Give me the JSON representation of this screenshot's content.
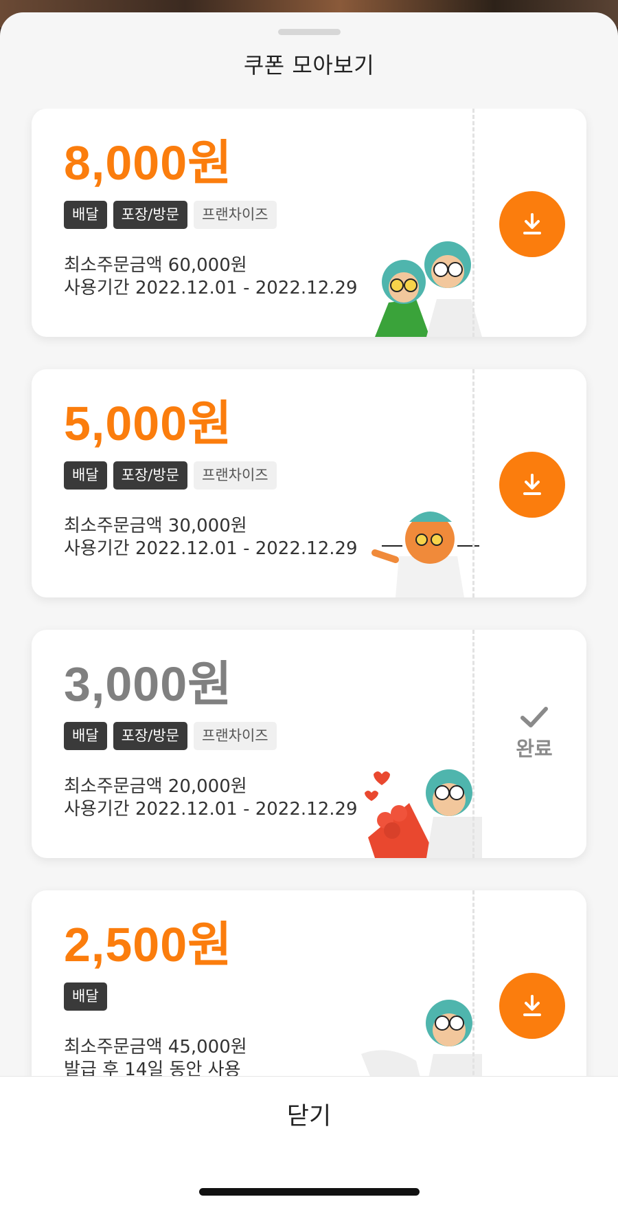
{
  "sheet": {
    "title": "쿠폰 모아보기",
    "close_label": "닫기"
  },
  "coupons": [
    {
      "amount": "8,000원",
      "state": "available",
      "tags": [
        "배달",
        "포장/방문",
        "프랜차이즈"
      ],
      "min_order": "최소주문금액 60,000원",
      "period": "사용기간 2022.12.01 - 2022.12.29"
    },
    {
      "amount": "5,000원",
      "state": "available",
      "tags": [
        "배달",
        "포장/방문",
        "프랜차이즈"
      ],
      "min_order": "최소주문금액 30,000원",
      "period": "사용기간 2022.12.01 - 2022.12.29"
    },
    {
      "amount": "3,000원",
      "state": "completed",
      "done_label": "완료",
      "tags": [
        "배달",
        "포장/방문",
        "프랜차이즈"
      ],
      "min_order": "최소주문금액 20,000원",
      "period": "사용기간 2022.12.01 - 2022.12.29"
    },
    {
      "amount": "2,500원",
      "state": "available",
      "tags": [
        "배달"
      ],
      "min_order": "최소주문금액 45,000원",
      "period": "발급 후 14일 동안 사용"
    }
  ],
  "colors": {
    "accent": "#fb7d0d",
    "disabled": "#808080",
    "tag_dark": "#3a3a3a",
    "tag_light": "#f0f0f0"
  },
  "icons": {
    "download": "download-icon",
    "check": "check-icon"
  }
}
